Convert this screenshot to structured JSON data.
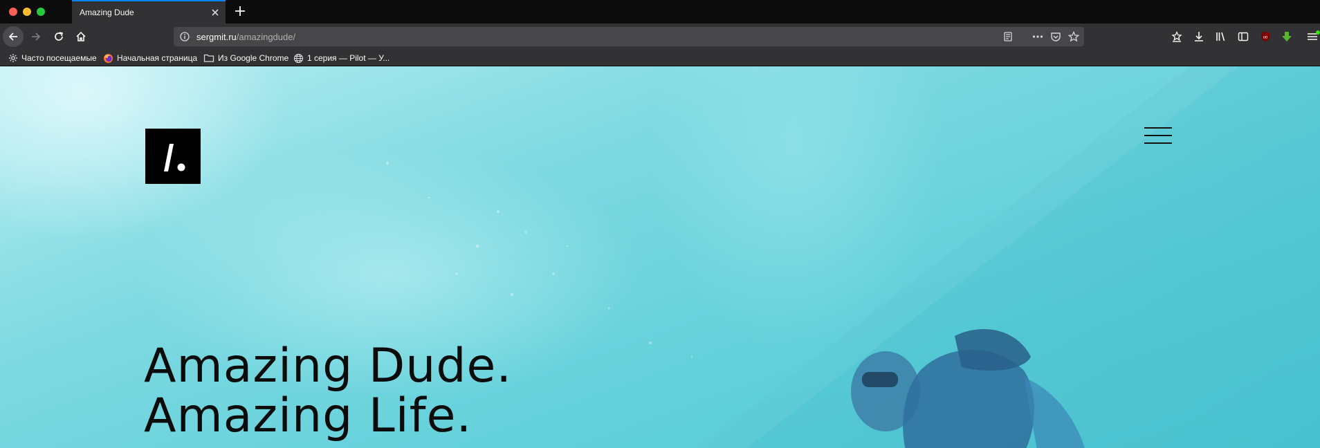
{
  "browser": {
    "tab": {
      "title": "Amazing Dude"
    },
    "url": {
      "host": "sergmit.ru",
      "path": "/amazingdude/"
    },
    "bookmarks": [
      {
        "label": "Часто посещаемые",
        "icon": "gear-icon"
      },
      {
        "label": "Начальная страница",
        "icon": "firefox-icon"
      },
      {
        "label": "Из Google Chrome",
        "icon": "folder-icon"
      },
      {
        "label": "1 серия — Pilot — У...",
        "icon": "globe-icon"
      }
    ],
    "colors": {
      "tabbar": "#0c0c0d",
      "toolbar": "#323234",
      "urlbar": "#474749",
      "accent": "#0a84ff"
    }
  },
  "page": {
    "logo_text": "/.",
    "hero": {
      "line1": "Amazing Dude.",
      "line2": "Amazing Life."
    },
    "colors": {
      "background": "#5fcfd9",
      "text": "#0b0b0b"
    }
  }
}
